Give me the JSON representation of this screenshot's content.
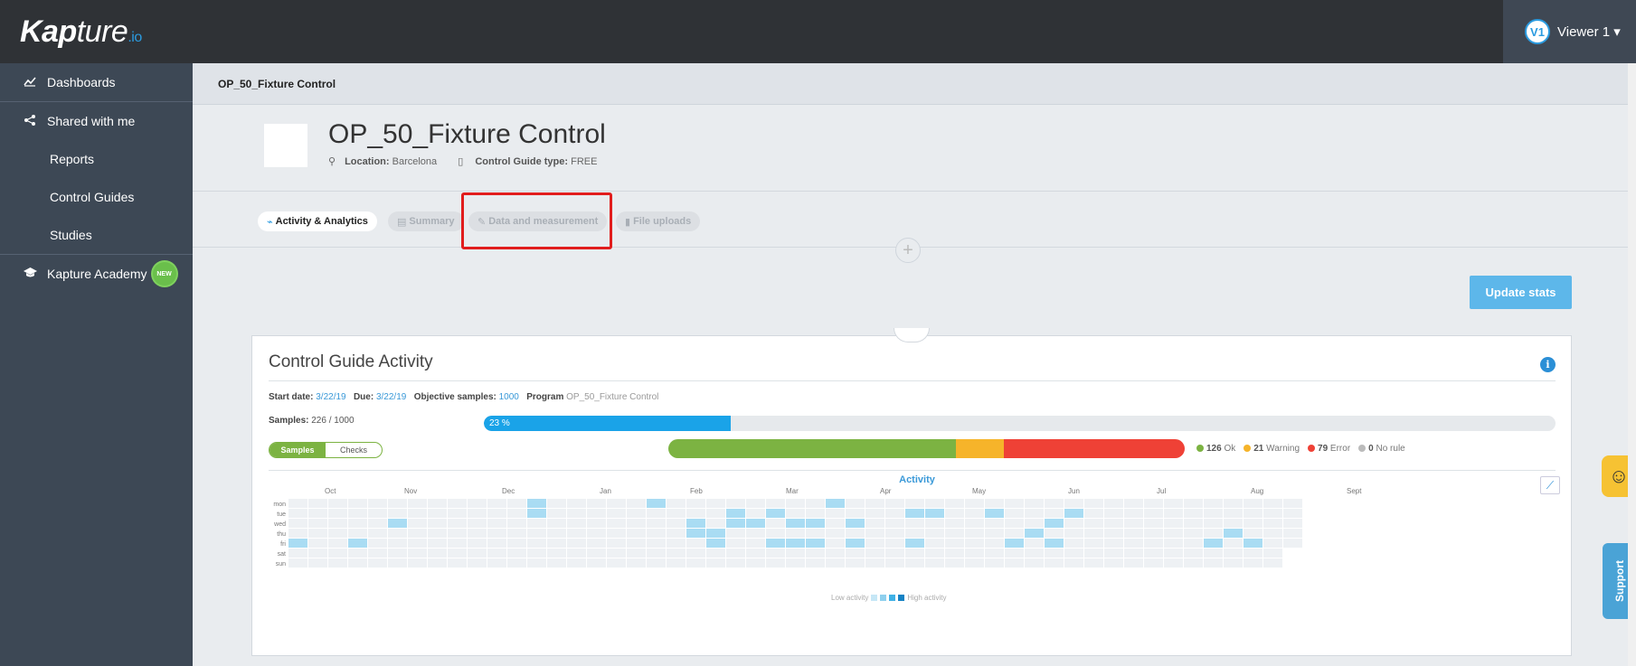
{
  "app": {
    "logo_main": "Kap",
    "logo_rest": "ture",
    "logo_suffix": ".io",
    "user_initials": "V1",
    "user_name": "Viewer 1 ▾"
  },
  "sidebar": {
    "items": [
      {
        "label": "Dashboards",
        "icon": "chart-line-icon"
      },
      {
        "label": "Shared with me",
        "icon": "share-icon"
      },
      {
        "label": "Reports"
      },
      {
        "label": "Control Guides"
      },
      {
        "label": "Studies"
      },
      {
        "label": "Kapture Academy",
        "icon": "graduation-cap-icon",
        "badge": "NEW"
      }
    ]
  },
  "breadcrumb": "OP_50_Fixture Control",
  "header": {
    "title": "OP_50_Fixture Control",
    "location_label": "Location:",
    "location_value": "Barcelona",
    "type_label": "Control Guide type:",
    "type_value": "FREE"
  },
  "tabs": [
    {
      "label": "Activity & Analytics",
      "icon": "activity-icon",
      "active": true
    },
    {
      "label": "Summary",
      "icon": "document-icon",
      "active": false
    },
    {
      "label": "Data and measurement",
      "icon": "pencil-icon",
      "active": false
    },
    {
      "label": "File uploads",
      "icon": "file-icon",
      "active": false
    }
  ],
  "update_stats": "Update stats",
  "card": {
    "title": "Control Guide Activity",
    "start_label": "Start date:",
    "start_value": "3/22/19",
    "due_label": "Due:",
    "due_value": "3/22/19",
    "objective_label": "Objective samples:",
    "objective_value": "1000",
    "program_label": "Program",
    "program_value": "OP_50_Fixture Control",
    "samples_label": "Samples:",
    "samples_value": "226 / 1000",
    "progress_text": "23 %",
    "progress_fraction": 0.23,
    "toggle_on": "Samples",
    "toggle_off": "Checks",
    "status_counts": [
      {
        "count": "126",
        "label": "Ok",
        "color": "#7cb342",
        "value": 126
      },
      {
        "count": "21",
        "label": "Warning",
        "color": "#f6b42a",
        "value": 21
      },
      {
        "count": "79",
        "label": "Error",
        "color": "#ef4136",
        "value": 79
      },
      {
        "count": "0",
        "label": "No rule",
        "color": "#bbbbbb",
        "value": 0
      }
    ],
    "activity_title": "Activity",
    "months": [
      "Oct",
      "Nov",
      "Dec",
      "Jan",
      "Feb",
      "Mar",
      "Apr",
      "May",
      "Jun",
      "Jul",
      "Aug",
      "Sept"
    ],
    "days": [
      "mon",
      "tue",
      "wed",
      "thu",
      "fri",
      "sat",
      "sun"
    ],
    "low_label": "Low activity",
    "high_label": "High activity",
    "active_cells": [
      [
        0,
        4
      ],
      [
        3,
        4
      ],
      [
        5,
        2
      ],
      [
        12,
        0
      ],
      [
        12,
        1
      ],
      [
        18,
        0
      ],
      [
        20,
        2
      ],
      [
        20,
        3
      ],
      [
        21,
        3
      ],
      [
        21,
        4
      ],
      [
        22,
        1
      ],
      [
        22,
        2
      ],
      [
        23,
        2
      ],
      [
        24,
        1
      ],
      [
        24,
        4
      ],
      [
        25,
        2
      ],
      [
        25,
        4
      ],
      [
        26,
        4
      ],
      [
        26,
        2
      ],
      [
        27,
        0
      ],
      [
        28,
        4
      ],
      [
        28,
        2
      ],
      [
        31,
        4
      ],
      [
        31,
        1
      ],
      [
        32,
        1
      ],
      [
        35,
        1
      ],
      [
        36,
        4
      ],
      [
        37,
        3
      ],
      [
        38,
        2
      ],
      [
        38,
        4
      ],
      [
        39,
        1
      ],
      [
        47,
        3
      ],
      [
        46,
        4
      ],
      [
        48,
        4
      ]
    ]
  },
  "right_widgets": {
    "smiley": "☺",
    "support": "Support"
  }
}
